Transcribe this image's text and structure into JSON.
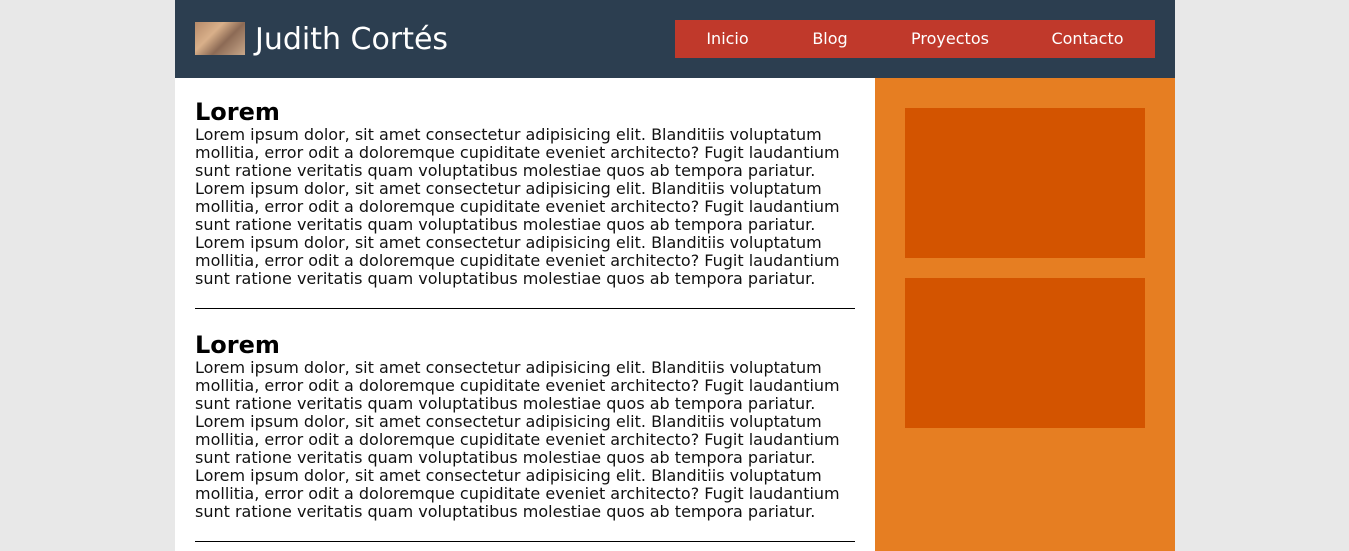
{
  "header": {
    "logo_alt": "cat photo",
    "title": "Judith Cortés"
  },
  "nav": {
    "items": [
      {
        "label": "Inicio"
      },
      {
        "label": "Blog"
      },
      {
        "label": "Proyectos"
      },
      {
        "label": "Contacto"
      }
    ]
  },
  "posts": [
    {
      "title": "Lorem",
      "paragraphs": [
        "Lorem ipsum dolor, sit amet consectetur adipisicing elit. Blanditiis voluptatum mollitia, error odit a doloremque cupiditate eveniet architecto? Fugit laudantium sunt ratione veritatis quam voluptatibus molestiae quos ab tempora pariatur.",
        "Lorem ipsum dolor, sit amet consectetur adipisicing elit. Blanditiis voluptatum mollitia, error odit a doloremque cupiditate eveniet architecto? Fugit laudantium sunt ratione veritatis quam voluptatibus molestiae quos ab tempora pariatur.",
        "Lorem ipsum dolor, sit amet consectetur adipisicing elit. Blanditiis voluptatum mollitia, error odit a doloremque cupiditate eveniet architecto? Fugit laudantium sunt ratione veritatis quam voluptatibus molestiae quos ab tempora pariatur."
      ]
    },
    {
      "title": "Lorem",
      "paragraphs": [
        "Lorem ipsum dolor, sit amet consectetur adipisicing elit. Blanditiis voluptatum mollitia, error odit a doloremque cupiditate eveniet architecto? Fugit laudantium sunt ratione veritatis quam voluptatibus molestiae quos ab tempora pariatur.",
        "Lorem ipsum dolor, sit amet consectetur adipisicing elit. Blanditiis voluptatum mollitia, error odit a doloremque cupiditate eveniet architecto? Fugit laudantium sunt ratione veritatis quam voluptatibus molestiae quos ab tempora pariatur.",
        "Lorem ipsum dolor, sit amet consectetur adipisicing elit. Blanditiis voluptatum mollitia, error odit a doloremque cupiditate eveniet architecto? Fugit laudantium sunt ratione veritatis quam voluptatibus molestiae quos ab tempora pariatur."
      ]
    }
  ],
  "colors": {
    "header_bg": "#2c3e50",
    "nav_bg": "#c0392b",
    "sidebar_bg": "#e67e22",
    "widget_bg": "#d35400",
    "page_bg": "#e8e8e8"
  }
}
